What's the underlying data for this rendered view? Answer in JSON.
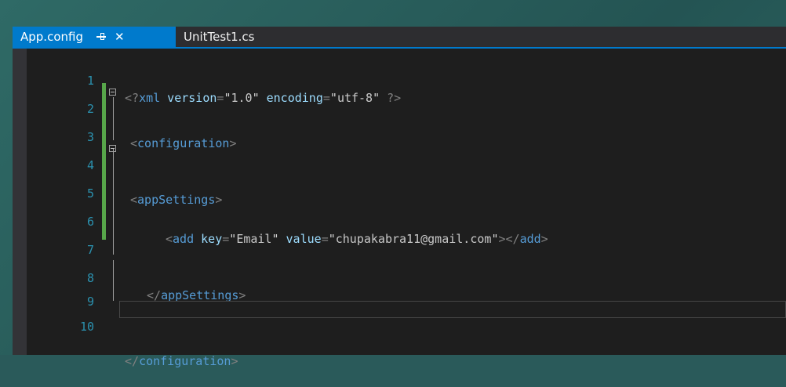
{
  "tabs": [
    {
      "label": "App.config",
      "active": true
    },
    {
      "label": "UnitTest1.cs",
      "active": false
    }
  ],
  "icons": {
    "pin": "pin-icon",
    "close": "close-icon",
    "fold": "fold-minus-icon"
  },
  "colors": {
    "accent": "#007acc",
    "editor_bg": "#1e1e1e",
    "line_number": "#2b91af",
    "tag": "#569cd6",
    "attr": "#9cdcfe",
    "change_bar": "#57a64a"
  },
  "lines": [
    {
      "num": "1",
      "text": "<?xml version=\"1.0\" encoding=\"utf-8\" ?>"
    },
    {
      "num": "2",
      "text": "<configuration>"
    },
    {
      "num": "3",
      "text": ""
    },
    {
      "num": "4",
      "text": "<appSettings>"
    },
    {
      "num": "5",
      "text": ""
    },
    {
      "num": "6",
      "text": "    <add key=\"Email\" value=\"chupakabra11@gmail.com\"></add>"
    },
    {
      "num": "7",
      "text": ""
    },
    {
      "num": "8",
      "text": "  </appSettings>"
    },
    {
      "num": "9",
      "text": ""
    },
    {
      "num": "10",
      "text": "</configuration>"
    }
  ],
  "tokens": {
    "l1": {
      "a": "<?",
      "b": "xml",
      "c": " version",
      "d": "=",
      "e": "\"",
      "f": "1.0",
      "g": "\"",
      "h": " encoding",
      "i": "=",
      "j": "\"",
      "k": "utf-8",
      "l": "\"",
      "m": " ?>"
    },
    "l2": {
      "a": "<",
      "b": "configuration",
      "c": ">"
    },
    "l4": {
      "a": "<",
      "b": "appSettings",
      "c": ">"
    },
    "l6": {
      "a": "<",
      "b": "add",
      "c": " key",
      "d": "=",
      "e": "\"",
      "f": "Email",
      "g": "\"",
      "h": " value",
      "i": "=",
      "j": "\"",
      "k": "chupakabra11@gmail.com",
      "l": "\"",
      "m": "></",
      "n": "add",
      "o": ">"
    },
    "l8": {
      "a": "</",
      "b": "appSettings",
      "c": ">"
    },
    "l10": {
      "a": "</",
      "b": "configuration",
      "c": ">"
    }
  }
}
